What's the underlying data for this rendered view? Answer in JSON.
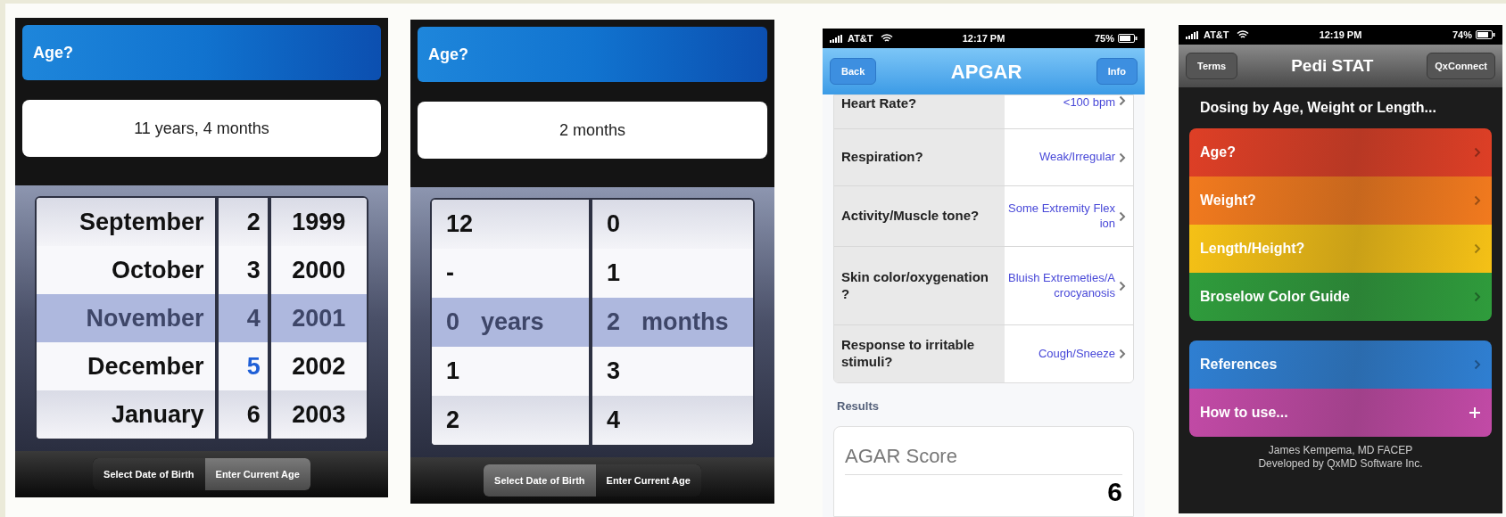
{
  "panels": [
    {
      "kind": "age_picker",
      "title": "Age?",
      "value": "11 years, 4 months",
      "picker": {
        "rows": [
          {
            "cells": [
              "September",
              "2",
              "1999"
            ],
            "selected": false,
            "current": false
          },
          {
            "cells": [
              "October",
              "3",
              "2000"
            ],
            "selected": false,
            "current": false
          },
          {
            "cells": [
              "November",
              "4",
              "2001"
            ],
            "selected": true,
            "current": false
          },
          {
            "cells": [
              "December",
              "5",
              "2002"
            ],
            "selected": false,
            "current": true
          },
          {
            "cells": [
              "January",
              "6",
              "2003"
            ],
            "selected": false,
            "current": false
          }
        ]
      },
      "segments": [
        {
          "label": "Select Date of Birth",
          "selected": false
        },
        {
          "label": "Enter Current Age",
          "selected": true
        }
      ]
    },
    {
      "kind": "age_picker",
      "title": "Age?",
      "value": "2 months",
      "picker": {
        "unit_labels": [
          "years",
          "months"
        ],
        "rows": [
          {
            "cells": [
              "12",
              "0"
            ],
            "selected": false
          },
          {
            "cells": [
              "-",
              "1"
            ],
            "selected": false
          },
          {
            "cells": [
              "0",
              "2"
            ],
            "selected": true
          },
          {
            "cells": [
              "1",
              "3"
            ],
            "selected": false
          },
          {
            "cells": [
              "2",
              "4"
            ],
            "selected": false
          }
        ]
      },
      "segments": [
        {
          "label": "Select Date of Birth",
          "selected": true
        },
        {
          "label": "Enter Current Age",
          "selected": false
        }
      ]
    },
    {
      "kind": "score_form",
      "status_bar": {
        "carrier": "AT&T",
        "time": "12:17 PM",
        "battery": "75%"
      },
      "nav": {
        "left": "Back",
        "title": "APGAR",
        "right": "Info"
      },
      "rows": [
        {
          "label": "Heart Rate?",
          "value": "<100 bpm"
        },
        {
          "label": "Respiration?",
          "value": "Weak/Irregular"
        },
        {
          "label": "Activity/Muscle tone?",
          "value": "Some Extremity Flexion"
        },
        {
          "label": "Skin color/oxygenation ?",
          "value": "Bluish Extremeties/Acrocyanosis"
        },
        {
          "label": "Response to irritable stimuli?",
          "value": "Cough/Sneeze"
        }
      ],
      "section": "Results",
      "result": {
        "label": "AGAR Score",
        "value": "6"
      }
    },
    {
      "kind": "menu",
      "status_bar": {
        "carrier": "AT&T",
        "time": "12:19 PM",
        "battery": "74%"
      },
      "nav": {
        "left": "Terms",
        "title": "Pedi STAT",
        "right": "QxConnect"
      },
      "heading": "Dosing by Age, Weight or Length...",
      "groups": [
        [
          {
            "label": "Age?",
            "color": "#de3f26",
            "kind": "chevron"
          },
          {
            "label": "Weight?",
            "color": "#f27a1e",
            "kind": "chevron"
          },
          {
            "label": "Length/Height?",
            "color": "#f5c116",
            "kind": "chevron"
          },
          {
            "label": "Broselow Color Guide",
            "color": "#2f9c3c",
            "kind": "chevron"
          }
        ],
        [
          {
            "label": "References",
            "color": "#2f7fd2",
            "kind": "chevron"
          },
          {
            "label": "How to use...",
            "color": "#c24aa6",
            "kind": "plus"
          }
        ]
      ],
      "footer": [
        "James Kempema, MD FACEP",
        "Developed by QxMD Software Inc."
      ]
    }
  ]
}
